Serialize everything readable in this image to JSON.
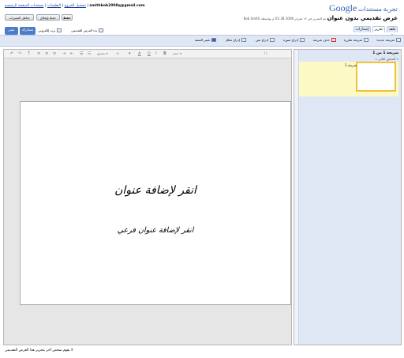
{
  "top_links": {
    "sign_out": "تسجيل الخروج",
    "help": "التعليمات",
    "docs_home": "مستندات الصفحة الرئيسية",
    "email": "smithbob2008q@gmail.com"
  },
  "top_buttons": {
    "save": "حفظ",
    "save_close": "حفظ وإغلاق",
    "discard": "تجاهل التغييرات"
  },
  "logo": {
    "google": "Google",
    "product": "مستندات",
    "beta": "تجربة"
  },
  "doc": {
    "title": "عرض تقديمي بدون عنوان",
    "edited_info": "تم التحرير في ١٧ فبراير 2008 01:38 م بواسطة",
    "editor": "Bob Smith"
  },
  "menus": {
    "file": "ملف ▾",
    "edit": "تحرير",
    "revisions": "إصدارات"
  },
  "actions": {
    "start_presentation": "بدء العرض التقديمي",
    "email": "بريد إلكتروني",
    "share": "مشاركة",
    "publish": "نشر"
  },
  "toolbar": {
    "new_slide": "شريحة جديدة",
    "duplicate_slide": "شريحة مكررة",
    "delete_slide": "حذف شريحة",
    "insert_image": "إدراج صورة",
    "insert_text": "إدراج نص",
    "insert_shape": "إدراج شكل",
    "change_theme": "تغيير السمة"
  },
  "editor_toolbar": {
    "font": "أ أ",
    "style": "تنسيق ▾",
    "size": "حجم ▾"
  },
  "slide": {
    "title_placeholder": "انقر لإضافة عنوان",
    "subtitle_placeholder": "انقر لإضافة عنوان فرعي"
  },
  "panel": {
    "count": "شريحة 1 من 1",
    "prev": "« السابق",
    "next": "التالي »",
    "thumb_label": "شريحة 1"
  },
  "status": {
    "text": "لا يقوم شخص آخر بتحرير هذا العرض التقديمي"
  },
  "colors": {
    "accent": "#4c7cc8",
    "selected_bg": "#fdf9c4",
    "selected_border": "#f0c23b",
    "panel_bg": "#dfe7f5"
  }
}
